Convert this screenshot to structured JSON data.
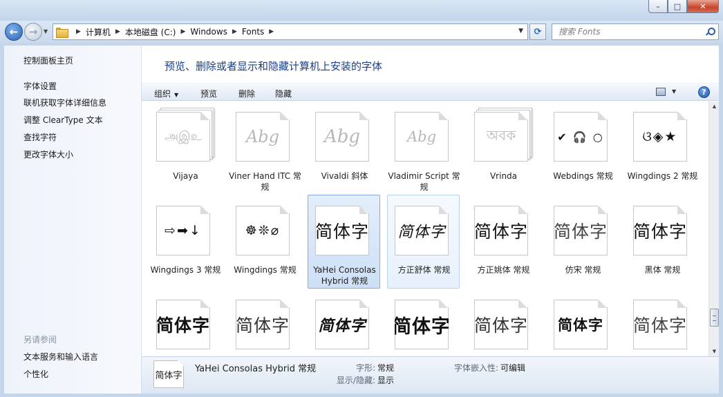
{
  "window": {
    "minimize_label": "–",
    "maximize_label": "□",
    "close_label": "✕"
  },
  "navigation": {
    "back_symbol": "←",
    "forward_symbol": "→",
    "breadcrumbs": [
      "计算机",
      "本地磁盘 (C:)",
      "Windows",
      "Fonts"
    ],
    "search_placeholder": "搜索 Fonts"
  },
  "sidebar": {
    "links": [
      "控制面板主页",
      "字体设置",
      "联机获取字体详细信息",
      "调整 ClearType 文本",
      "查找字符",
      "更改字体大小"
    ],
    "see_also_title": "另请参阅",
    "see_also_links": [
      "文本服务和输入语言",
      "个性化"
    ]
  },
  "main": {
    "heading": "预览、删除或者显示和隐藏计算机上安装的字体"
  },
  "toolbar": {
    "organize_label": "组织",
    "preview_label": "预览",
    "delete_label": "删除",
    "hide_label": "隐藏",
    "help_label": "?"
  },
  "fonts": [
    {
      "label": "Vijaya",
      "sample": "அஇஉ"
    },
    {
      "label": "Viner Hand ITC 常规",
      "sample": "Abg"
    },
    {
      "label": "Vivaldi 斜体",
      "sample": "Abg"
    },
    {
      "label": "Vladimir Script 常规",
      "sample": "Abg"
    },
    {
      "label": "Vrinda",
      "sample": "অবক"
    },
    {
      "label": "Webdings 常规",
      "sample": "✔ 🎧 ○"
    },
    {
      "label": "Wingdings 2 常规",
      "sample": "ଓ◈★"
    },
    {
      "label": "Wingdings 3 常规",
      "sample": "⇨➡↓"
    },
    {
      "label": "Wingdings 常规",
      "sample": "☸❊⌀"
    },
    {
      "label": "YaHei Consolas Hybrid 常规",
      "sample": "简体字"
    },
    {
      "label": "方正舒体 常规",
      "sample": "简体字"
    },
    {
      "label": "方正姚体 常规",
      "sample": "简体字"
    },
    {
      "label": "仿宋 常规",
      "sample": "简体字"
    },
    {
      "label": "黑体 常规",
      "sample": "简体字"
    },
    {
      "label": "",
      "sample": "简体字"
    },
    {
      "label": "",
      "sample": "简体字"
    },
    {
      "label": "",
      "sample": "简体字"
    },
    {
      "label": "",
      "sample": "简体字"
    },
    {
      "label": "",
      "sample": "简体字"
    },
    {
      "label": "",
      "sample": "简体字"
    },
    {
      "label": "",
      "sample": "简体字"
    }
  ],
  "details": {
    "thumb_sample": "简体字",
    "name": "YaHei Consolas Hybrid 常规",
    "style_key": "字形:",
    "style_value": "常规",
    "visibility_key": "显示/隐藏:",
    "visibility_value": "显示",
    "embed_key": "字体嵌入性:",
    "embed_value": "可编辑"
  },
  "scrollbar": {
    "up_symbol": "▲",
    "down_symbol": "▼"
  }
}
